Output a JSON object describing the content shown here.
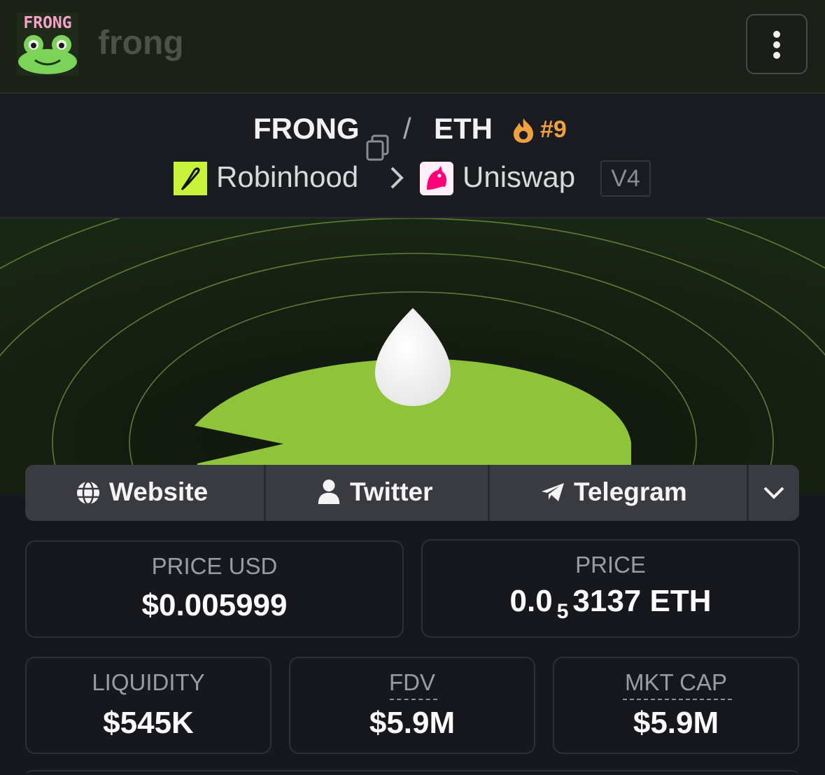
{
  "header": {
    "logo_text": "FRONG",
    "title": "frong",
    "menu_icon": "kebab-menu-icon"
  },
  "pair": {
    "base": "FRONG",
    "separator": "/",
    "quote": "ETH",
    "trending_rank": "#9",
    "chain": "Robinhood",
    "dex": "Uniswap",
    "version": "V4"
  },
  "socials": {
    "website": "Website",
    "twitter": "Twitter",
    "telegram": "Telegram",
    "more_icon": "chevron-down-icon"
  },
  "stats": {
    "price_usd_label": "PRICE USD",
    "price_usd_value": "$0.005999",
    "price_label": "PRICE",
    "price_prefix": "0.0",
    "price_zero_count": "5",
    "price_suffix": "3137 ETH",
    "liquidity_label": "LIQUIDITY",
    "liquidity_value": "$545K",
    "fdv_label": "FDV",
    "fdv_value": "$5.9M",
    "mktcap_label": "MKT CAP",
    "mktcap_value": "$5.9M"
  },
  "colors": {
    "accent_orange": "#f0a040",
    "lily_green": "#8fc33a",
    "robinhood_green": "#c6f33a",
    "background": "#17181e"
  }
}
